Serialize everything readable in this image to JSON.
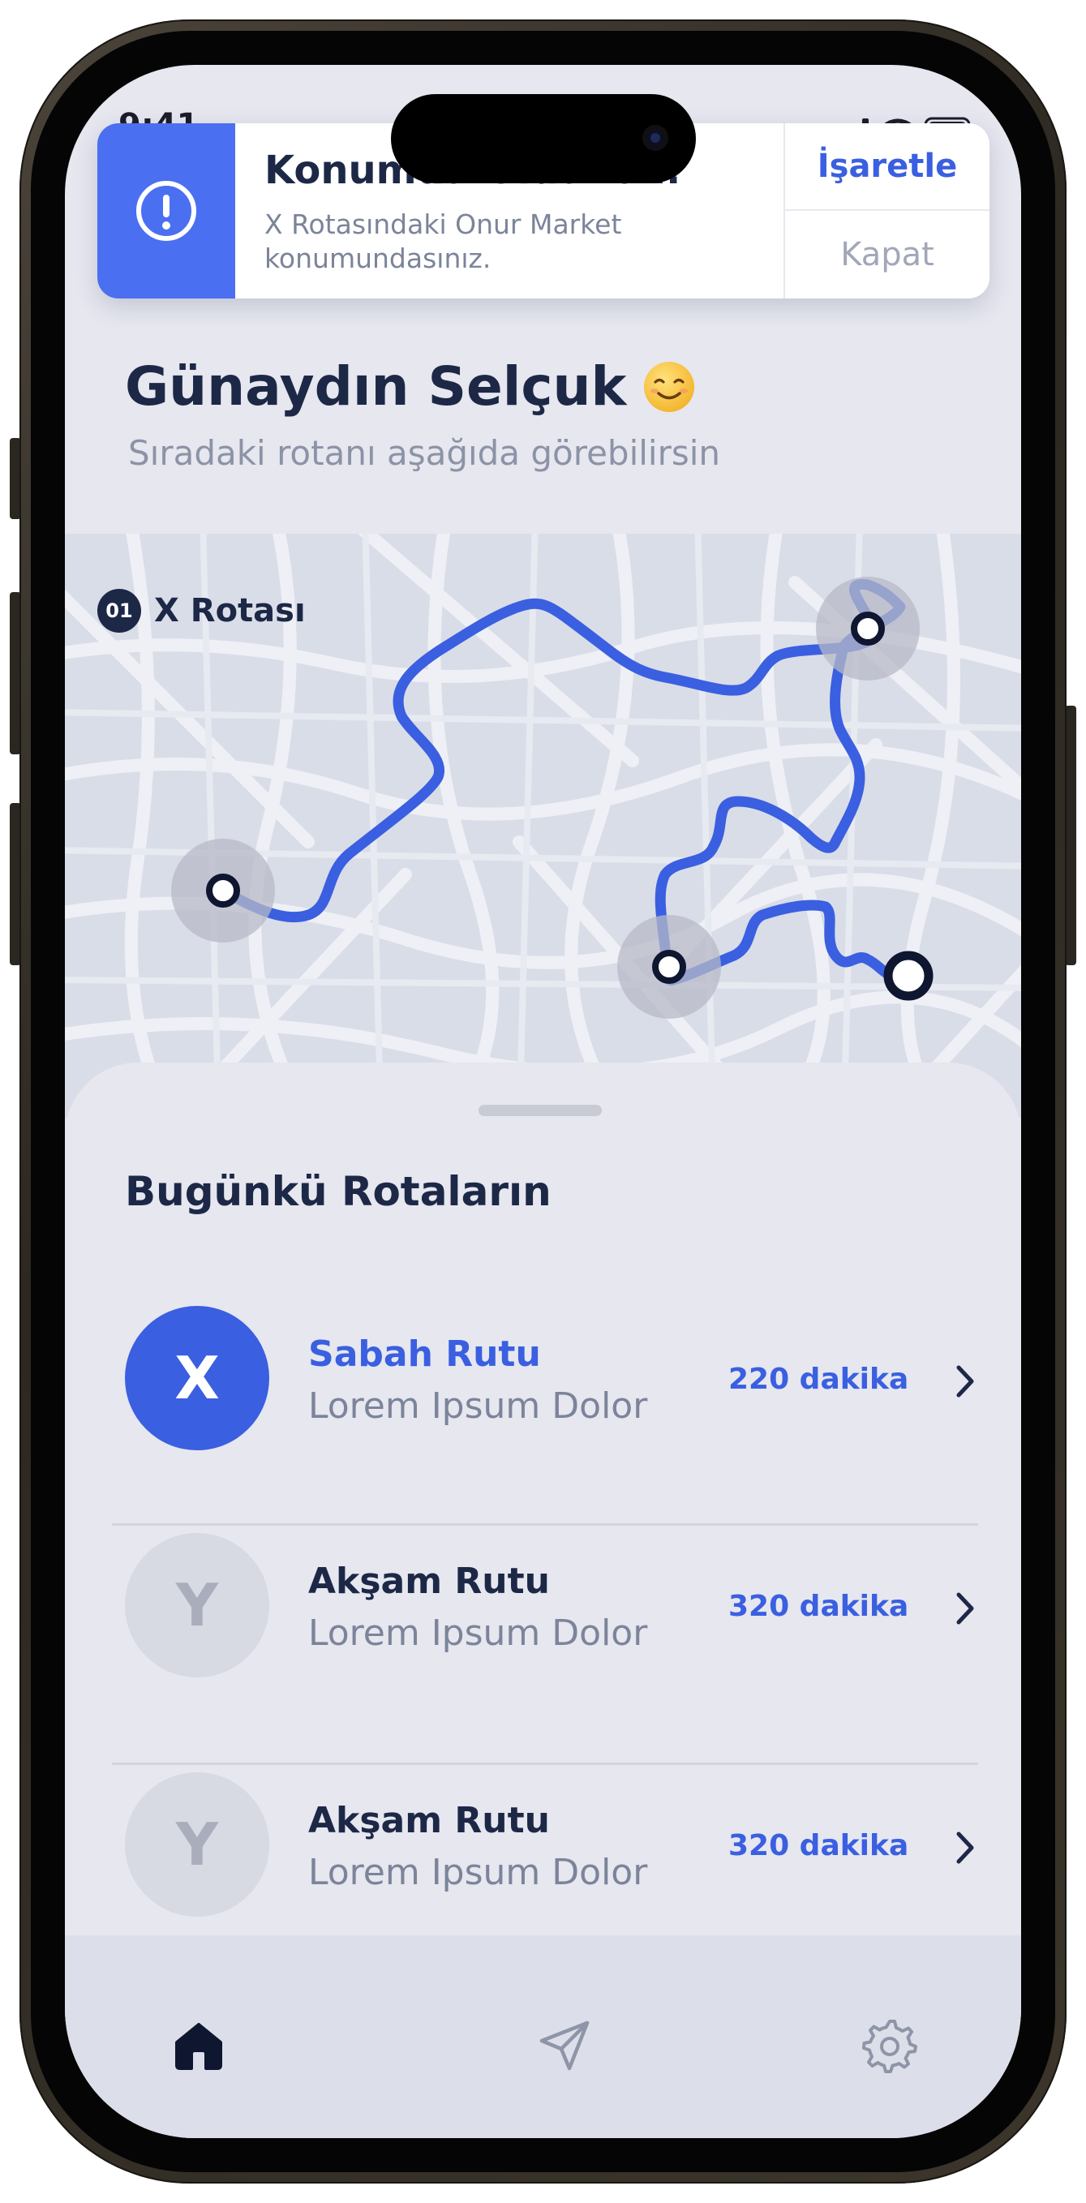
{
  "status": {
    "time": "9:41"
  },
  "notification": {
    "title": "Konumda Oldunuz!",
    "body": "X Rotasındaki Onur Market konumundasınız.",
    "mark_label": "İşaretle",
    "close_label": "Kapat",
    "icon": "alert-circle-icon"
  },
  "greeting": {
    "title": "Günaydın Selçuk",
    "subtitle": "Sıradaki rotanı aşağıda görebilirsin",
    "emoji_icon": "smiling-face-icon"
  },
  "map": {
    "route_number": "01",
    "route_name": "X Rotası"
  },
  "routes": {
    "section_title": "Bugünkü Rotaların",
    "items": [
      {
        "letter": "X",
        "name": "Sabah Rutu",
        "description": "Lorem Ipsum Dolor",
        "duration": "220 dakika",
        "active": true
      },
      {
        "letter": "Y",
        "name": "Akşam Rutu",
        "description": "Lorem Ipsum Dolor",
        "duration": "320 dakika",
        "active": false
      },
      {
        "letter": "Y",
        "name": "Akşam Rutu",
        "description": "Lorem Ipsum Dolor",
        "duration": "320 dakika",
        "active": false
      }
    ]
  },
  "tabbar": {
    "items": [
      "home-icon",
      "send-icon",
      "gear-icon"
    ],
    "active": "home-icon"
  },
  "colors": {
    "accent": "#3a5fe0",
    "notif_accent": "#4a6ff0",
    "dark_text": "#1d2847",
    "route_line": "#3a5fe0",
    "background": "#e6e7ef"
  }
}
